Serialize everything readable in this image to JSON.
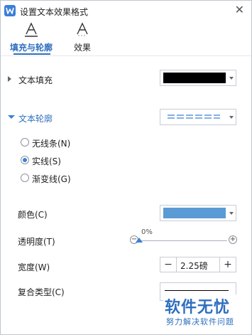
{
  "window": {
    "title": "设置文本效果格式",
    "close_glyph": "✕"
  },
  "tabs": [
    {
      "label": "填充与轮廓",
      "glyph": "A"
    },
    {
      "label": "效果",
      "glyph": "A"
    }
  ],
  "text_fill": {
    "label": "文本填充",
    "color": "#000000"
  },
  "text_outline": {
    "label": "文本轮廓",
    "options": [
      {
        "label": "无线条(N)",
        "selected": false
      },
      {
        "label": "实线(S)",
        "selected": true
      },
      {
        "label": "渐变线(G)",
        "selected": false
      }
    ]
  },
  "color": {
    "label": "颜色(C)",
    "value": "#5b9bd5"
  },
  "transparency": {
    "label": "透明度(T)",
    "value": "0%",
    "fraction": 0
  },
  "width": {
    "label": "宽度(W)",
    "value": "2.25磅",
    "minus": "−",
    "plus": "+"
  },
  "compound_type": {
    "label": "复合类型(C)"
  },
  "watermark": {
    "title": "软件无忧",
    "subtitle": "努力解决软件问题"
  },
  "colors": {
    "accent": "#2e6fbf",
    "radio_accent": "#3b7fd9"
  }
}
